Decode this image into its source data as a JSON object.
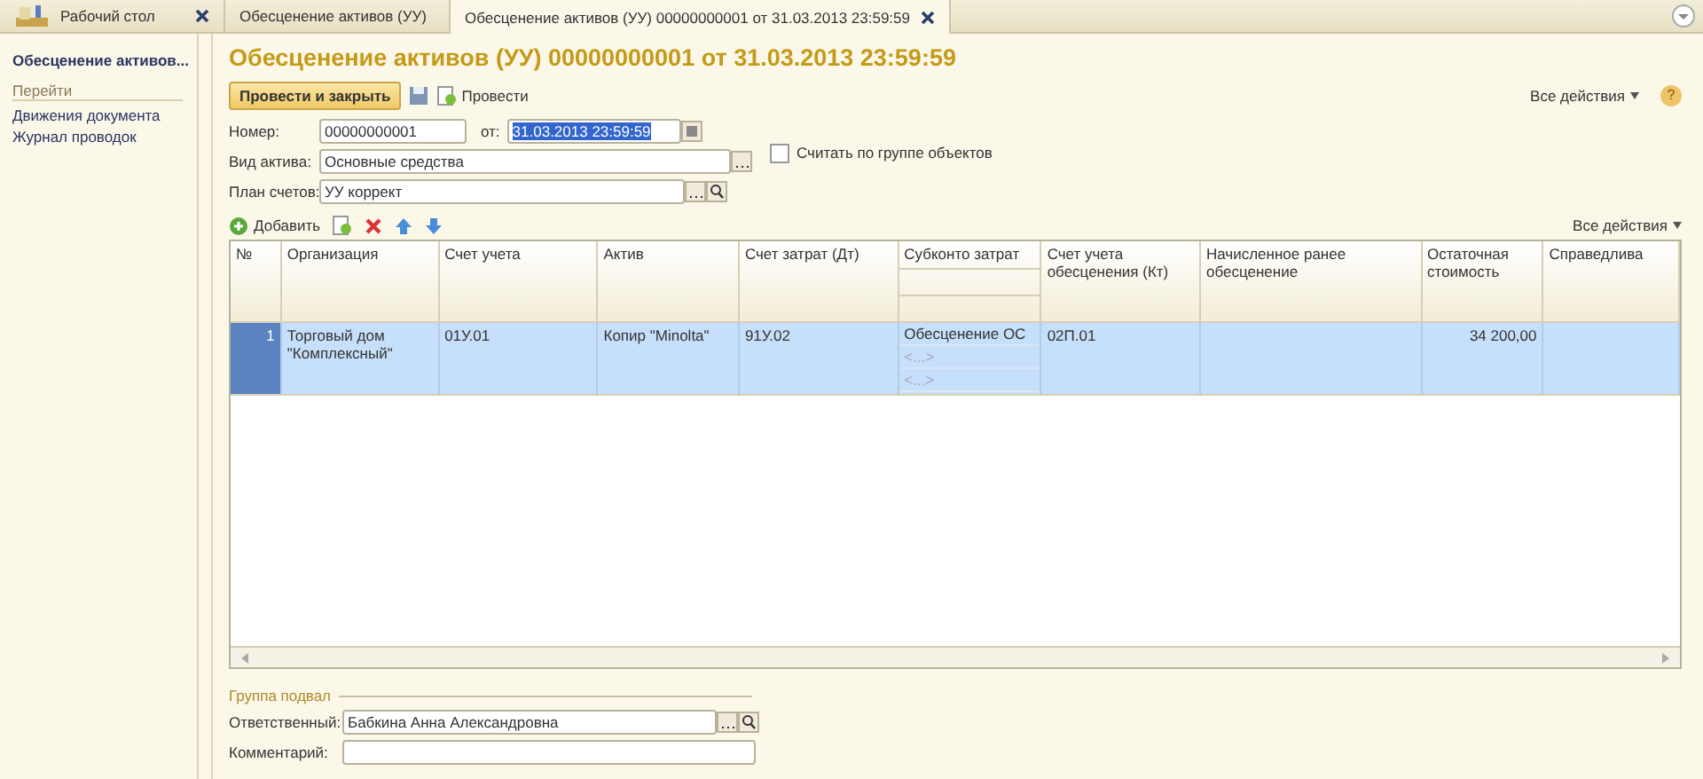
{
  "tabs": [
    {
      "label": "Рабочий стол",
      "selected": false,
      "kind": "home"
    },
    {
      "label": "Обесценение активов (УУ)",
      "selected": false,
      "kind": "doc"
    },
    {
      "label": "Обесценение активов (УУ) 00000000001 от 31.03.2013 23:59:59",
      "selected": true,
      "kind": "doc"
    }
  ],
  "sidebar": {
    "title": "Обесценение активов...",
    "section": "Перейти",
    "items": [
      "Движения документа",
      "Журнал проводок"
    ]
  },
  "form": {
    "title": "Обесценение активов (УУ) 00000000001 от 31.03.2013 23:59:59",
    "toolbar": {
      "primary": "Провести и закрыть",
      "post": "Провести",
      "all_actions": "Все действия",
      "help": "?"
    },
    "number": {
      "label": "Номер:",
      "value": "00000000001"
    },
    "date": {
      "label": "от:",
      "value": "31.03.2013 23:59:59"
    },
    "asset_type": {
      "label": "Вид актива:",
      "value": "Основные средства"
    },
    "by_group": {
      "label": "Считать по группе объектов",
      "checked": false
    },
    "chart_of_accounts": {
      "label": "План счетов:",
      "value": "УУ коррект"
    },
    "table_toolbar": {
      "add": "Добавить",
      "all_actions": "Все действия"
    },
    "table": {
      "columns": [
        "№",
        "Организация",
        "Счет учета",
        "Актив",
        "Счет затрат (Дт)",
        "Субконто затрат",
        "Счет учета обесценения (Кт)",
        "Начисленное ранее обесценение",
        "Остаточная стоимость",
        "Справедлива"
      ],
      "rows": [
        {
          "selected": true,
          "cells": [
            "1",
            "Торговый дом \"Комплексный\"",
            "01У.01",
            "Копир \"Minolta\"",
            "91У.02",
            [
              "Обесценение ОС",
              "<...>",
              "<...>"
            ],
            "02П.01",
            "",
            "34 200,00",
            ""
          ]
        }
      ]
    },
    "footer": {
      "group": "Группа подвал",
      "responsible": {
        "label": "Ответственный:",
        "value": "Бабкина Анна Александровна"
      },
      "comment": {
        "label": "Комментарий:"
      }
    }
  }
}
